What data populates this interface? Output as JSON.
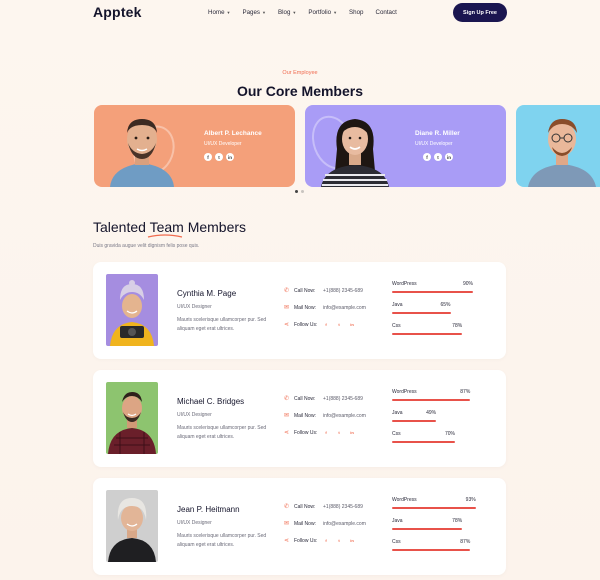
{
  "nav": {
    "logo": "Apptek",
    "items": [
      "Home",
      "Pages",
      "Blog",
      "Portfolio",
      "Shop",
      "Contact"
    ],
    "signup_label": "Sign Up Free"
  },
  "core": {
    "eyebrow": "Our Employee",
    "title": "Our Core Members",
    "cards": [
      {
        "name": "Albert P. Lechance",
        "role": "UI/UX Developer",
        "color": "#f4a07a"
      },
      {
        "name": "Diane R. Miller",
        "role": "UI/UX Developer",
        "color": "#a99cf6"
      },
      {
        "name": "",
        "role": "",
        "color": "#7fd3ef"
      }
    ],
    "social_icons": [
      "f",
      "t",
      "in"
    ]
  },
  "talented": {
    "title": "Talented Team Members",
    "subtitle": "Duis gravida augue velit dignism felis pose quis."
  },
  "labels": {
    "call": "Call Now:",
    "mail": "Mail Now:",
    "follow": "Follow Us:"
  },
  "members": [
    {
      "name": "Cynthia M. Page",
      "role": "UI/UX Designer",
      "desc": "Mauris scelerisque ullamcorper pur. Sed aliquam eget erat ultrices.",
      "phone": "+1(888) 2345-689",
      "email": "info@example.com",
      "skills": [
        {
          "name": "WordPress",
          "pct": 90,
          "label": "90%"
        },
        {
          "name": "Java",
          "pct": 65,
          "label": "65%"
        },
        {
          "name": "Css",
          "pct": 78,
          "label": "78%"
        }
      ]
    },
    {
      "name": "Michael C. Bridges",
      "role": "UI/UX Designer",
      "desc": "Mauris scelerisque ullamcorper pur. Sed aliquam eget erat ultrices.",
      "phone": "+1(888) 2345-689",
      "email": "info@example.com",
      "skills": [
        {
          "name": "WordPress",
          "pct": 87,
          "label": "87%"
        },
        {
          "name": "Java",
          "pct": 49,
          "label": "49%"
        },
        {
          "name": "Css",
          "pct": 70,
          "label": "70%"
        }
      ]
    },
    {
      "name": "Jean P. Heitmann",
      "role": "UI/UX Designer",
      "desc": "Mauris scelerisque ullamcorper pur. Sed aliquam eget erat ultrices.",
      "phone": "+1(888) 2345-689",
      "email": "info@example.com",
      "skills": [
        {
          "name": "WordPress",
          "pct": 93,
          "label": "93%"
        },
        {
          "name": "Java",
          "pct": 78,
          "label": "78%"
        },
        {
          "name": "Css",
          "pct": 87,
          "label": "87%"
        }
      ]
    }
  ],
  "colors": {
    "accent": "#f06b4f",
    "navy": "#1b1650",
    "bar": "#e8524a"
  }
}
